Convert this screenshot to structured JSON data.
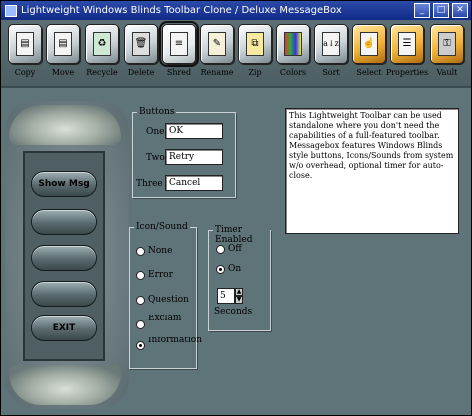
{
  "window": {
    "title": "Lightweight Windows Blinds Toolbar Clone / Deluxe MessageBox"
  },
  "toolbar": {
    "items": [
      {
        "label": "Copy",
        "icon": "copy-icon"
      },
      {
        "label": "Move",
        "icon": "move-icon"
      },
      {
        "label": "Recycle",
        "icon": "recycle-icon"
      },
      {
        "label": "Delete",
        "icon": "trash-icon"
      },
      {
        "label": "Shred",
        "icon": "shred-icon"
      },
      {
        "label": "Rename",
        "icon": "rename-icon"
      },
      {
        "label": "Zip",
        "icon": "zip-icon"
      },
      {
        "label": "Colors",
        "icon": "colors-icon"
      },
      {
        "label": "Sort",
        "icon": "sort-icon"
      },
      {
        "label": "Select",
        "icon": "select-icon"
      },
      {
        "label": "Properties",
        "icon": "properties-icon"
      },
      {
        "label": "Vault",
        "icon": "vault-icon"
      }
    ]
  },
  "side_panel": {
    "show_msg": "Show Msg",
    "exit": "EXIT"
  },
  "buttons_group": {
    "title": "Buttons",
    "one_label": "One",
    "one_value": "OK",
    "two_label": "Two",
    "two_value": "Retry",
    "three_label": "Three",
    "three_value": "Cancel"
  },
  "icon_sound_group": {
    "title": "Icon/Sound",
    "options": [
      "None",
      "Error",
      "Question",
      "Exclam",
      "Information"
    ],
    "selected": "Information"
  },
  "timer_group": {
    "title": "Timer Enabled",
    "off": "Off",
    "on": "On",
    "seconds_value": "5",
    "seconds_label": "Seconds"
  },
  "memo": {
    "text": "This Lightweight Toolbar can be used standalone where you don't need the capabilities of a full-featured toolbar. Messagebox features Windows Blinds style buttons, Icons/Sounds from system w/o overhead, optional timer for auto-close."
  }
}
